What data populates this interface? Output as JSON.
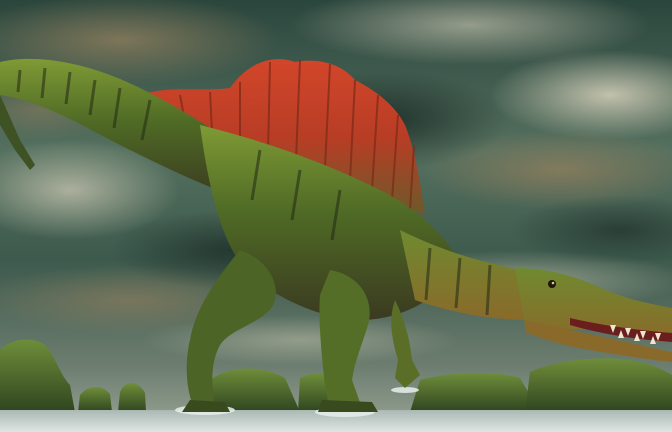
{
  "image": {
    "subject": "spinosaurus-icon",
    "palette": {
      "sky_dark": "#1f3a33",
      "sky_mid": "#4f6d5f",
      "cloud_light": "#c9c3ad",
      "cloud_warm": "#8a7a5c",
      "sail_red": "#c0452a",
      "sail_orange": "#d8793a",
      "body_green": "#5f7a2e",
      "body_dark": "#2e3a1c",
      "belly": "#6b5a3a",
      "water": "#c8d2d0",
      "rocks": "#4c6a30"
    }
  }
}
